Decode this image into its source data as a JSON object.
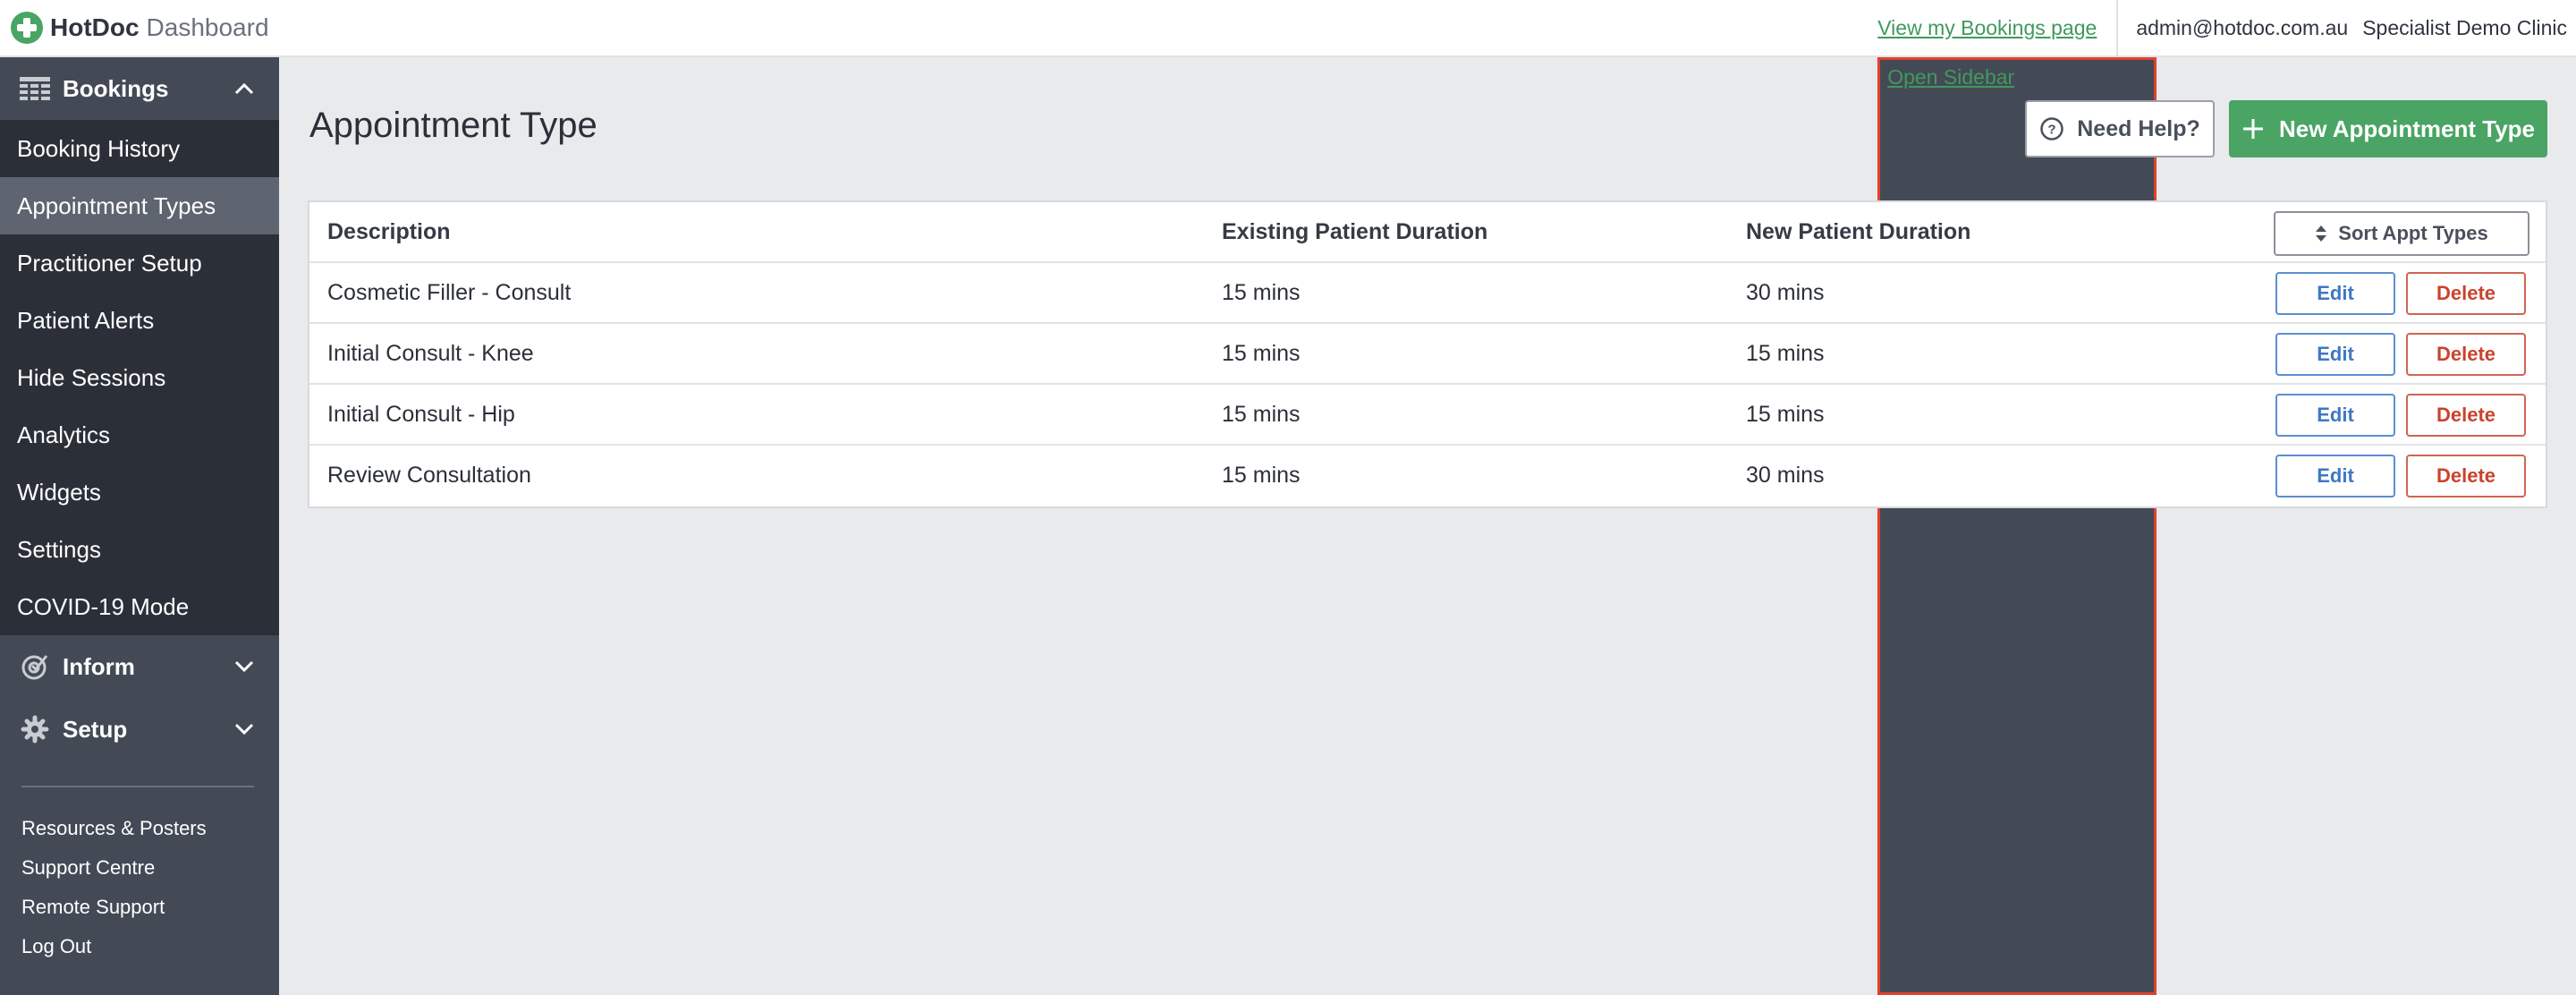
{
  "header": {
    "brand_name": "HotDoc",
    "brand_sub": "Dashboard",
    "links": {
      "bookings_page": "View my Bookings page",
      "open_sidebar": "Open Sidebar"
    },
    "user_email": "admin@hotdoc.com.au",
    "clinic_name": "Specialist Demo Clinic"
  },
  "sidebar": {
    "bookings": {
      "label": "Bookings",
      "expanded": true,
      "items": [
        {
          "label": "Booking History",
          "active": false
        },
        {
          "label": "Appointment Types",
          "active": true
        },
        {
          "label": "Practitioner Setup",
          "active": false
        },
        {
          "label": "Patient Alerts",
          "active": false
        },
        {
          "label": "Hide Sessions",
          "active": false
        },
        {
          "label": "Analytics",
          "active": false
        },
        {
          "label": "Widgets",
          "active": false
        },
        {
          "label": "Settings",
          "active": false
        },
        {
          "label": "COVID-19 Mode",
          "active": false
        }
      ]
    },
    "inform": {
      "label": "Inform",
      "expanded": false
    },
    "setup": {
      "label": "Setup",
      "expanded": false
    },
    "footer_links": [
      "Resources & Posters",
      "Support Centre",
      "Remote Support",
      "Log Out"
    ]
  },
  "main": {
    "title": "Appointment Type",
    "help_button": "Need Help?",
    "new_button": "New Appointment Type",
    "table": {
      "columns": [
        "Description",
        "Existing Patient Duration",
        "New Patient Duration"
      ],
      "sort_button": "Sort Appt Types",
      "edit_label": "Edit",
      "delete_label": "Delete",
      "rows": [
        {
          "description": "Cosmetic Filler - Consult",
          "existing": "15 mins",
          "new": "30 mins"
        },
        {
          "description": "Initial Consult - Knee",
          "existing": "15 mins",
          "new": "15 mins"
        },
        {
          "description": "Initial Consult - Hip",
          "existing": "15 mins",
          "new": "15 mins"
        },
        {
          "description": "Review Consultation",
          "existing": "15 mins",
          "new": "30 mins"
        }
      ]
    }
  },
  "colors": {
    "brand_green": "#4aa464",
    "link_green": "#3f9a5c",
    "sidebar_bg": "#434a56",
    "sidebar_sub_bg": "#2b2f38",
    "active_item_bg": "#5e6470",
    "edit_blue": "#3f78c4",
    "delete_red": "#c9432d",
    "highlight_outline": "#e0412c"
  },
  "icons": {
    "brand": "hotdoc-logo-icon",
    "bookings": "grid-table-icon",
    "inform": "target-check-icon",
    "setup": "gear-icon",
    "help": "question-circle-icon",
    "new": "plus-icon",
    "sort": "sort-arrows-icon",
    "expand": "chevron-icon"
  }
}
